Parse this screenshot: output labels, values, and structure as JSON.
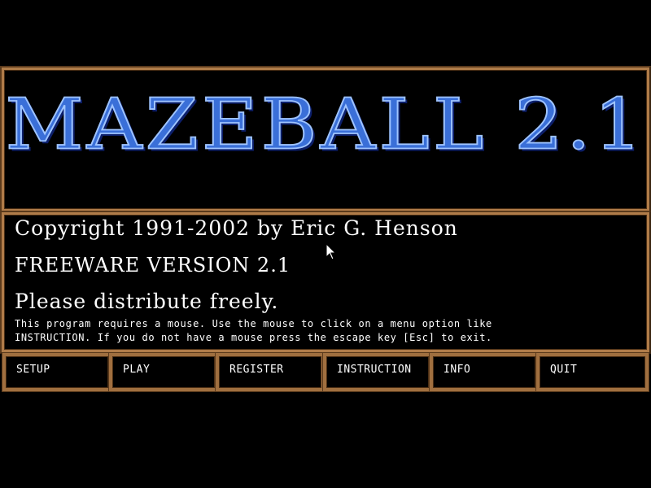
{
  "app": {
    "title": "MAZEBALL 2.1"
  },
  "info": {
    "copyright": "Copyright 1991-2002 by Eric G. Henson",
    "freeware": "FREEWARE VERSION 2.1",
    "distribute": "Please distribute freely.",
    "instructions_line1": "This program requires a mouse. Use the mouse to click on a menu option like",
    "instructions_line2": "INSTRUCTION. If you do not have a mouse press the escape key [Esc] to exit."
  },
  "menu": {
    "items": [
      {
        "label": "SETUP"
      },
      {
        "label": "PLAY"
      },
      {
        "label": "REGISTER"
      },
      {
        "label": "INSTRUCTION"
      },
      {
        "label": "INFO"
      },
      {
        "label": "QUIT"
      }
    ]
  },
  "colors": {
    "background": "#000000",
    "frame": "#b07c49",
    "title_fill": "#3a6fd8",
    "title_outline": "#9fc4ff",
    "text": "#ffffff"
  },
  "icons": {
    "cursor": "mouse-pointer-icon"
  }
}
